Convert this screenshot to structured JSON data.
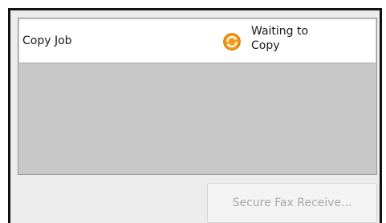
{
  "job_list": {
    "rows": [
      {
        "job_name": "Copy Job",
        "status_line1": "Waiting to",
        "status_line2": "Copy",
        "status_icon": "refresh-icon"
      }
    ]
  },
  "actions": {
    "secure_fax_receive_label": "Secure Fax Receive..."
  },
  "colors": {
    "frame_border": "#111111",
    "panel_background": "#ececec",
    "list_background": "#c8c8c8",
    "status_icon_orange": "#f39a1e",
    "disabled_text": "#a9a9a9"
  }
}
